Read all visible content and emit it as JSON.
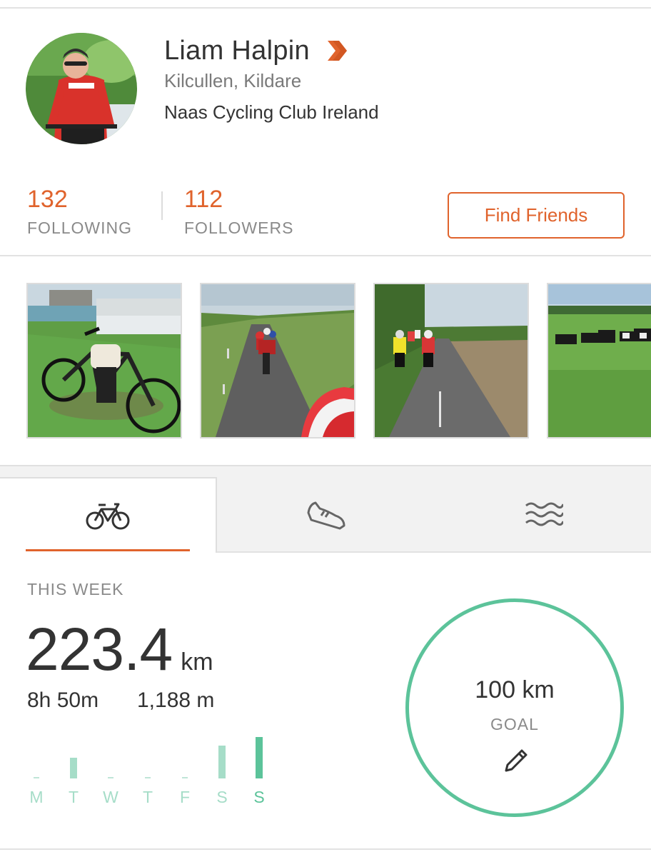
{
  "profile": {
    "name": "Liam Halpin",
    "location": "Kilcullen, Kildare",
    "club": "Naas Cycling Club Ireland",
    "badge_icon": "premium-chevron-icon"
  },
  "stats": {
    "following_count": "132",
    "following_label": "FOLLOWING",
    "followers_count": "112",
    "followers_label": "FOLLOWERS",
    "find_friends_label": "Find Friends"
  },
  "photos": [
    {
      "icon": "bike-by-canal-photo"
    },
    {
      "icon": "group-ride-photo"
    },
    {
      "icon": "road-riders-photo"
    },
    {
      "icon": "cows-field-photo"
    }
  ],
  "tabs": [
    {
      "icon": "bike-icon",
      "active": true
    },
    {
      "icon": "shoe-icon",
      "active": false
    },
    {
      "icon": "waves-icon",
      "active": false
    }
  ],
  "week": {
    "label": "THIS WEEK",
    "distance": "223.4",
    "distance_unit": "km",
    "time": "8h 50m",
    "elevation": "1,188 m",
    "days": [
      {
        "letter": "M",
        "value": 0
      },
      {
        "letter": "T",
        "value": 0.5
      },
      {
        "letter": "W",
        "value": 0
      },
      {
        "letter": "T",
        "value": 0
      },
      {
        "letter": "F",
        "value": 0
      },
      {
        "letter": "S",
        "value": 0.8
      },
      {
        "letter": "S",
        "value": 1.0,
        "current": true
      }
    ]
  },
  "goal": {
    "value": "100 km",
    "label": "GOAL",
    "edit_icon": "pencil-icon"
  },
  "colors": {
    "accent": "#e0632c",
    "goal_green": "#5cc39a",
    "bar_light": "#a6ddc8"
  }
}
